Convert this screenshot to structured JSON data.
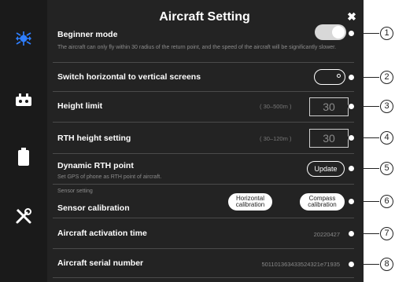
{
  "header": {
    "title": "Aircraft Setting",
    "close_glyph": "✖"
  },
  "sidebar": {
    "items": [
      {
        "icon": "drone-icon",
        "active": true
      },
      {
        "icon": "robot-icon",
        "active": false
      },
      {
        "icon": "battery-icon",
        "active": false
      },
      {
        "icon": "tools-icon",
        "active": false
      }
    ]
  },
  "settings": {
    "beginner_mode": {
      "label": "Beginner mode",
      "description": "The aircraft can only fly within 30 radius of the return point, and the speed of the aircraft will be significantly slower.",
      "enabled": true
    },
    "switch_screens": {
      "label": "Switch horizontal to vertical screens",
      "enabled": false
    },
    "height_limit": {
      "label": "Height limit",
      "range": "( 30–500m )",
      "value": "30"
    },
    "rth_height": {
      "label": "RTH height setting",
      "range": "( 30–120m )",
      "value": "30"
    },
    "dynamic_rth": {
      "label": "Dynamic RTH point",
      "description": "Set GPS of phone as RTH point of aircraft.",
      "button": "Update"
    },
    "sensor_calibration": {
      "section": "Sensor setting",
      "label": "Sensor calibration",
      "horizontal_button": "Horizontal calibration",
      "compass_button": "Compass calibration"
    },
    "activation_time": {
      "label": "Aircraft activation time",
      "value": "20220427"
    },
    "serial_number": {
      "label": "Aircraft serial number",
      "value": "501101363433524321e71935"
    }
  },
  "callouts": [
    "1",
    "2",
    "3",
    "4",
    "5",
    "6",
    "7",
    "8"
  ],
  "colors": {
    "panel": "#232323",
    "sidebar": "#1a1a1a",
    "accent": "#2f7fff",
    "text": "#ffffff"
  }
}
